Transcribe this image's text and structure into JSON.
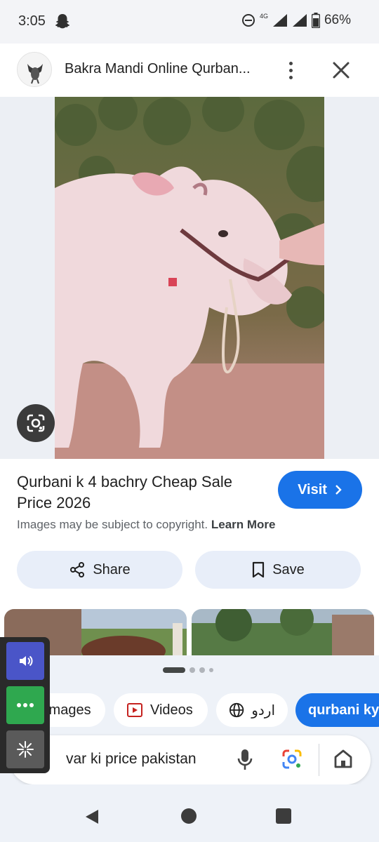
{
  "status_bar": {
    "time": "3:05",
    "network": "4G",
    "battery": "66%"
  },
  "header": {
    "title": "Bakra Mandi Online Qurban..."
  },
  "image_info": {
    "title": "Qurbani k 4 bachry Cheap Sale Price 2026",
    "visit_label": "Visit",
    "copyright_text": "Images may be subject to copyright.",
    "learn_more": "Learn More"
  },
  "actions": {
    "share_label": "Share",
    "save_label": "Save"
  },
  "chips": [
    {
      "label": "Images"
    },
    {
      "label": "Videos"
    },
    {
      "label": "اردو"
    },
    {
      "label": "qurbani ky"
    }
  ],
  "search": {
    "query": "var ki price pakistan"
  },
  "icons": {
    "snapchat": "ghost-icon",
    "more": "more-vert-icon",
    "close": "close-icon",
    "lens": "google-lens-icon",
    "visit_arrow": "chevron-right-icon",
    "share": "share-icon",
    "save": "bookmark-icon",
    "videos": "video-icon",
    "language": "globe-icon",
    "mic": "mic-icon",
    "home": "home-icon"
  },
  "colors": {
    "accent": "#1a73e8",
    "chip_bg": "#e8eef9",
    "sheet_bg": "#eef2f8"
  }
}
